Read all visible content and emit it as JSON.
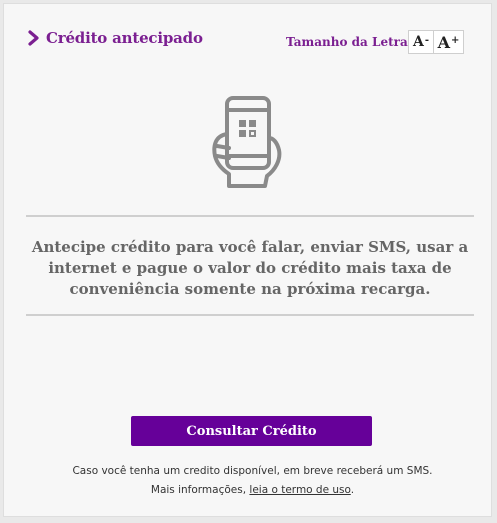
{
  "header": {
    "title": "Crédito antecipado",
    "title_icon": "chevron-right-icon",
    "font_size_label": "Tamanho da Letra",
    "decrease_label": "A",
    "decrease_sup": "-",
    "increase_label": "A",
    "increase_sup": "+"
  },
  "illustration": {
    "icon": "phone-in-hand-icon"
  },
  "main": {
    "description": "Antecipe crédito para você falar, enviar SMS, usar a internet e pague o valor do crédito mais taxa de conveniência somente na próxima recarga."
  },
  "action": {
    "button_label": "Consultar Crédito"
  },
  "footer": {
    "text_before": "Caso você tenha um credito disponível, em breve receberá um SMS. Mais informações,",
    "link_text": "leia o termo de uso",
    "text_after": "."
  },
  "colors": {
    "brand_purple": "#660099",
    "title_purple": "#7b1f91",
    "icon_gray": "#8a8a8a"
  }
}
